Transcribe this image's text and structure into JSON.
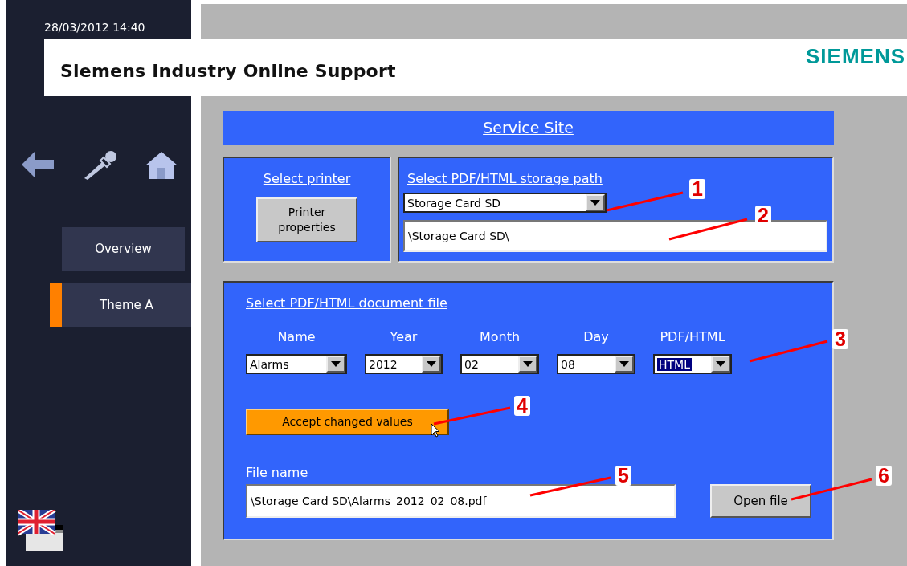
{
  "datetime": "28/03/2012 14:40",
  "header": {
    "title": "Siemens Industry Online Support",
    "logo": "SIEMENS"
  },
  "nav": [
    {
      "label": "Overview",
      "selected": false
    },
    {
      "label": "Theme A",
      "selected": true
    }
  ],
  "page_title": "Service Site",
  "printer_panel": {
    "title": "Select printer",
    "button": "Printer properties"
  },
  "storage_panel": {
    "title": "Select PDF/HTML storage path",
    "dropdown": "Storage Card SD",
    "path": "\\Storage Card SD\\"
  },
  "document_panel": {
    "title": "Select PDF/HTML document file",
    "selectors": [
      {
        "label": "Name",
        "value": "Alarms",
        "selected": false
      },
      {
        "label": "Year",
        "value": "2012",
        "selected": false
      },
      {
        "label": "Month",
        "value": "02",
        "selected": false
      },
      {
        "label": "Day",
        "value": "08",
        "selected": false
      },
      {
        "label": "PDF/HTML",
        "value": "HTML",
        "selected": true
      }
    ],
    "accept_button": "Accept changed values",
    "file_label": "File name",
    "file_value": "\\Storage Card SD\\Alarms_2012_02_08.pdf",
    "open_button": "Open file"
  },
  "callouts": [
    {
      "number": "1"
    },
    {
      "number": "2"
    },
    {
      "number": "3"
    },
    {
      "number": "4"
    },
    {
      "number": "5"
    },
    {
      "number": "6"
    }
  ]
}
